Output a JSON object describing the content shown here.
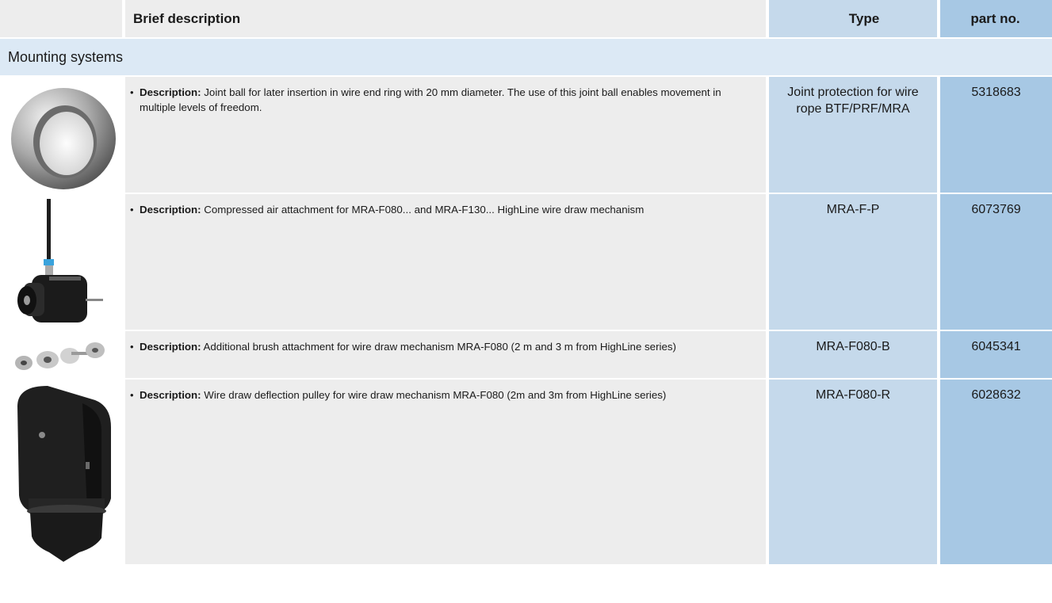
{
  "header": {
    "description": "Brief description",
    "type": "Type",
    "part_no": "part no."
  },
  "section": {
    "title": "Mounting systems"
  },
  "rows": [
    {
      "image_icon": "joint-ball-icon",
      "desc_label": "Description:",
      "desc_text": "Joint ball for later insertion in wire end ring with 20 mm diameter. The use of this joint ball enables movement in multiple levels of freedom.",
      "type": "Joint protection for wire rope BTF/PRF/MRA",
      "part_no": "5318683"
    },
    {
      "image_icon": "compressed-air-attachment-icon",
      "desc_label": "Description:",
      "desc_text": "Compressed air attachment for MRA-F080... and MRA-F130... HighLine wire draw mechanism",
      "type": "MRA-F-P",
      "part_no": "6073769"
    },
    {
      "image_icon": "brush-attachment-icon",
      "desc_label": "Description:",
      "desc_text": "Additional brush attachment for wire draw mechanism MRA-F080 (2 m and 3 m from HighLine series)",
      "type": "MRA-F080-B",
      "part_no": "6045341"
    },
    {
      "image_icon": "deflection-pulley-icon",
      "desc_label": "Description:",
      "desc_text": "Wire draw deflection pulley for wire draw mechanism MRA-F080 (2m and 3m from HighLine series)",
      "type": "MRA-F080-R",
      "part_no": "6028632"
    }
  ]
}
